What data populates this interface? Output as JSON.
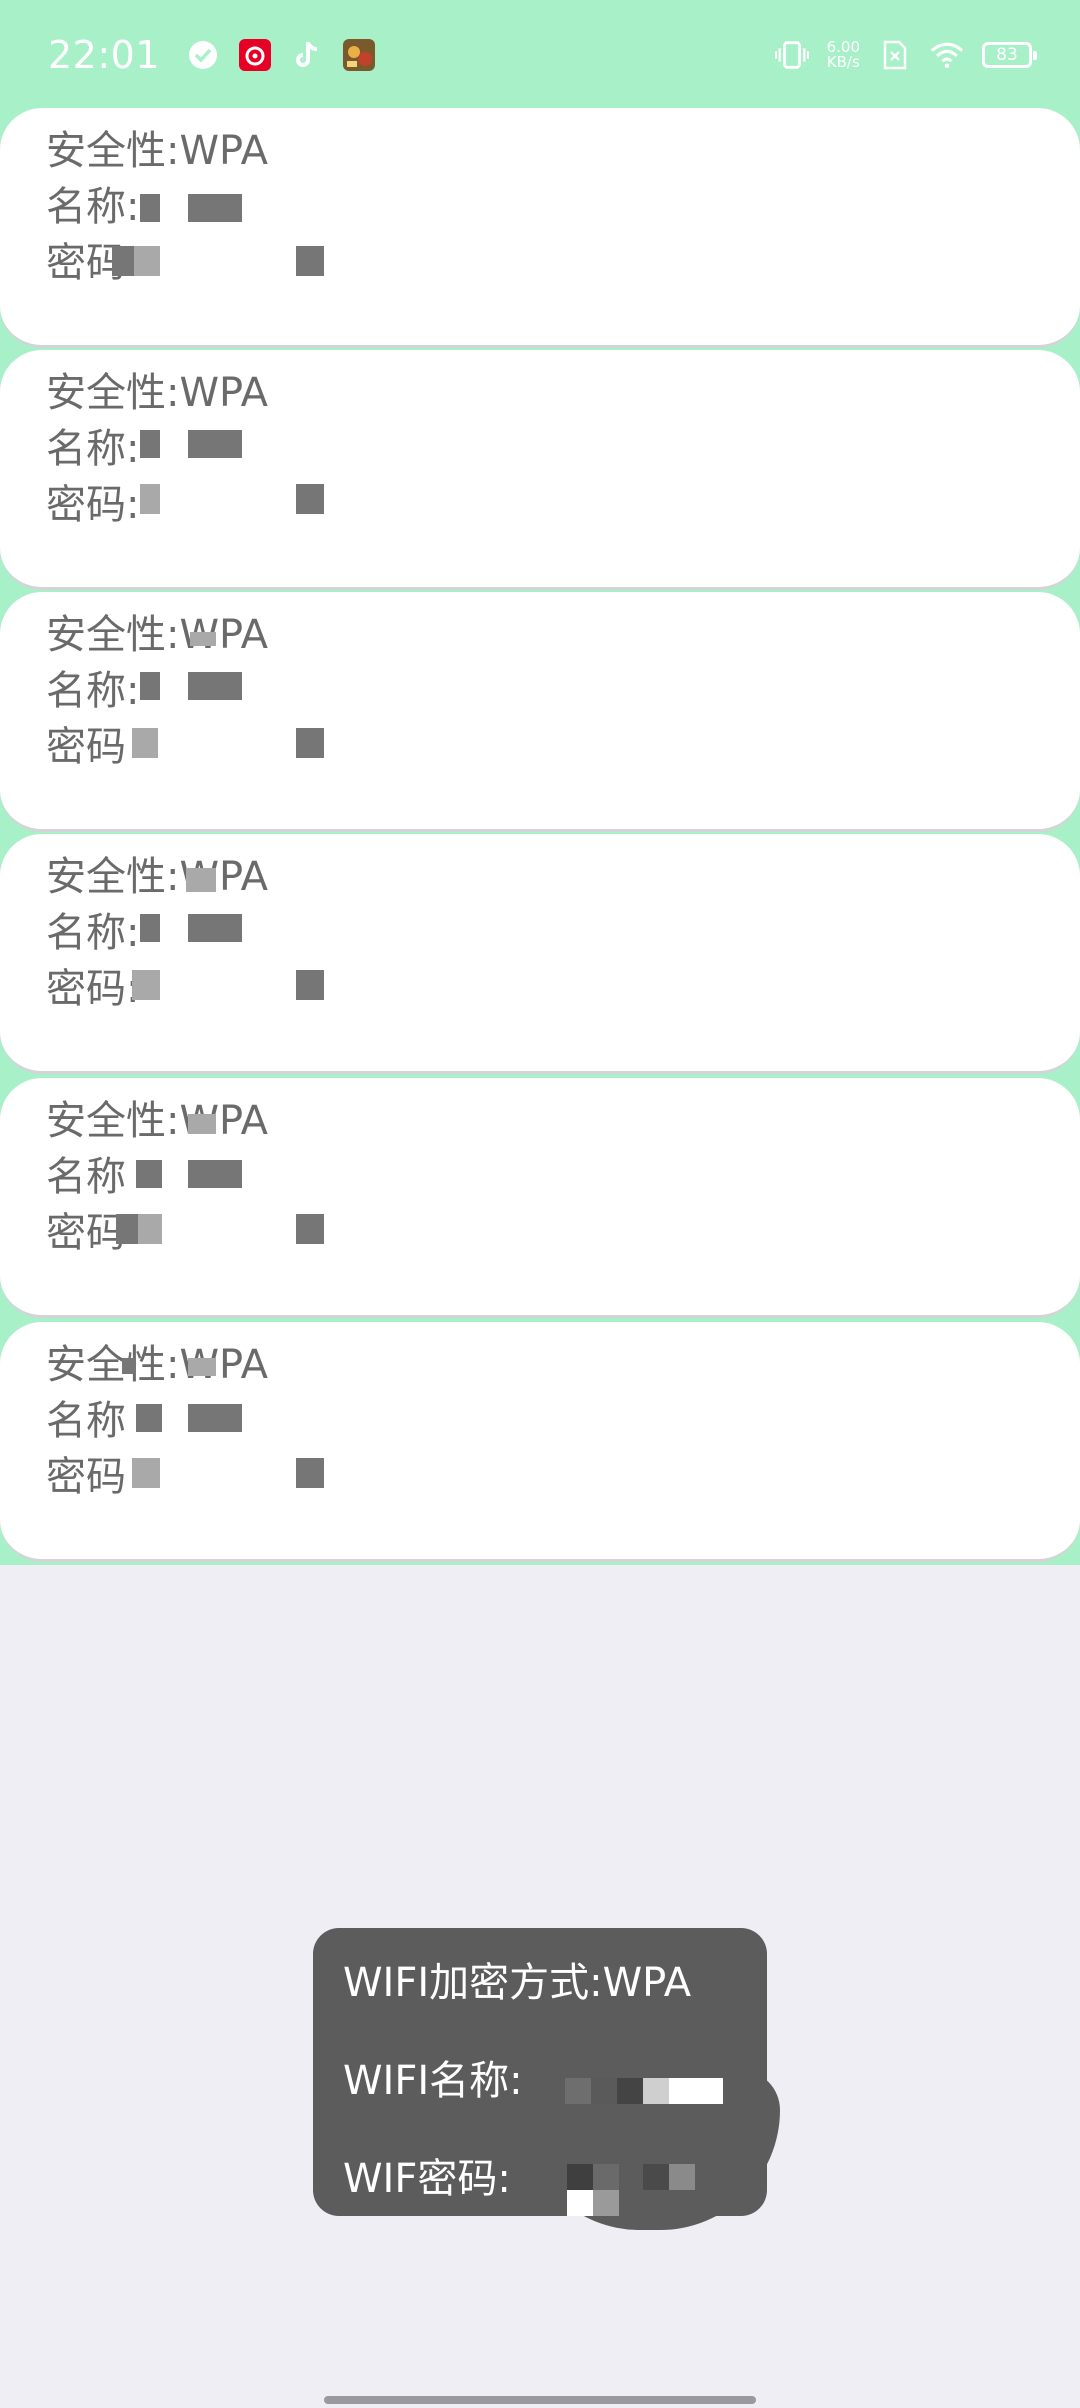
{
  "status_bar": {
    "time": "22:01",
    "net_speed_value": "6.00",
    "net_speed_unit": "KB/s",
    "battery": "83",
    "left_icons": [
      "check-circle-icon",
      "netease-music-icon",
      "tiktok-icon",
      "game-avatar-icon"
    ],
    "right_icons": [
      "vibrate-icon",
      "sim-off-icon",
      "wifi-icon",
      "battery-icon"
    ]
  },
  "colors": {
    "header_green": "#a8f0c8",
    "page_bg": "#eeeef4",
    "card_bg": "#ffffff",
    "toast_bg": "#5c5c5c"
  },
  "wifi_list": [
    {
      "security_label": "安全性:WPA",
      "name_label": "名称:",
      "password_label": "密码"
    },
    {
      "security_label": "安全性:WPA",
      "name_label": "名称:",
      "password_label": "密码:"
    },
    {
      "security_label": "安全性:WPA",
      "name_label": "名称:",
      "password_label": "密码"
    },
    {
      "security_label": "安全性:WPA",
      "name_label": "名称:",
      "password_label": "密码:"
    },
    {
      "security_label": "安全性:WPA",
      "name_label": "名称",
      "password_label": "密码"
    },
    {
      "security_label": "安全性:WPA",
      "name_label": "名称",
      "password_label": "密码"
    }
  ],
  "toast": {
    "encryption_label": "WIFI加密方式:WPA",
    "name_label": "WIFI名称:",
    "password_label": "WIF密码:"
  }
}
